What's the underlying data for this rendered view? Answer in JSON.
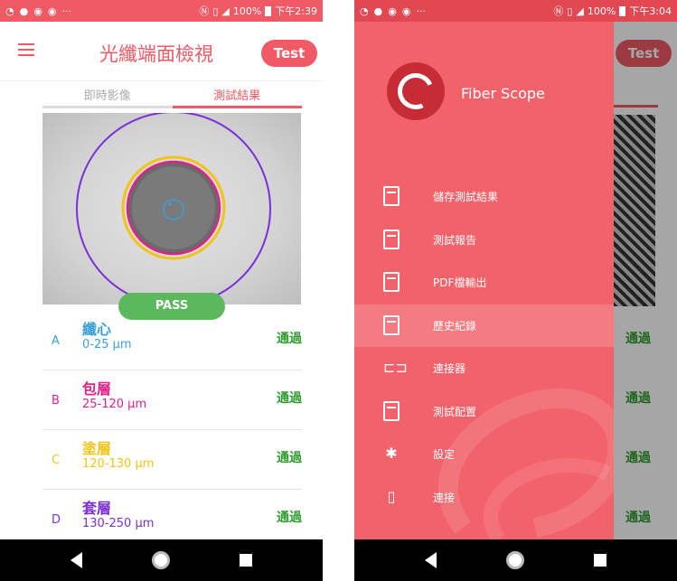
{
  "status_left": {
    "time": "下午2:39",
    "battery": "100%",
    "dots": "···"
  },
  "status_right": {
    "time": "下午3:04",
    "battery": "100%",
    "dots": "···"
  },
  "header": {
    "title": "光纖端面檢視",
    "test_button": "Test"
  },
  "tabs": [
    {
      "label": "即時影像",
      "active": false
    },
    {
      "label": "測試結果",
      "active": true
    }
  ],
  "result_badge": "PASS",
  "zones": [
    {
      "letter": "A",
      "name": "纖心",
      "range": "0-25 µm",
      "status": "通過",
      "color": "#3aa0d8"
    },
    {
      "letter": "B",
      "name": "包層",
      "range": "25-120 µm",
      "status": "通過",
      "color": "#e0218a"
    },
    {
      "letter": "C",
      "name": "塗層",
      "range": "120-130 µm",
      "status": "通過",
      "color": "#f0c419"
    },
    {
      "letter": "D",
      "name": "套層",
      "range": "130-250 µm",
      "status": "通過",
      "color": "#7b2fd6"
    }
  ],
  "drawer": {
    "brand": "Fiber Scope",
    "items": [
      {
        "label": "儲存測試結果",
        "icon": "download-doc-icon",
        "selected": false
      },
      {
        "label": "測試報告",
        "icon": "report-doc-icon",
        "selected": false
      },
      {
        "label": "PDF檔輸出",
        "icon": "pdf-doc-icon",
        "selected": false
      },
      {
        "label": "歷史紀錄",
        "icon": "history-doc-icon",
        "selected": true
      },
      {
        "label": "連接器",
        "icon": "connector-icon",
        "selected": false
      },
      {
        "label": "測試配置",
        "icon": "config-doc-icon",
        "selected": false
      },
      {
        "label": "設定",
        "icon": "gear-icon",
        "selected": false
      },
      {
        "label": "連接",
        "icon": "phone-icon",
        "selected": false
      }
    ]
  },
  "background_peek": {
    "test_button": "Test",
    "statuses": [
      "通過",
      "通過",
      "通過",
      "通過"
    ]
  },
  "colors": {
    "primary": "#ef5a64",
    "drawer": "#f2626a",
    "pass": "#5cb85c",
    "status_green": "#2e9c2e"
  }
}
